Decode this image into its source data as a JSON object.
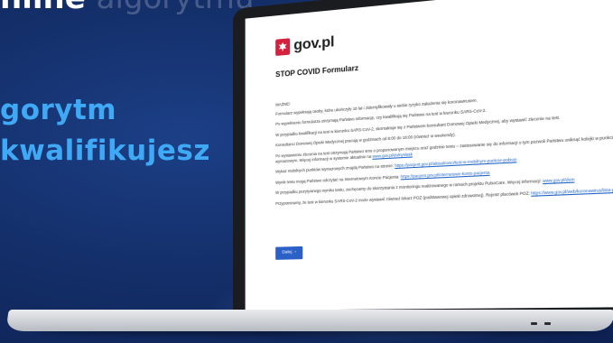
{
  "background": {
    "top_text": "nline",
    "top_text_faded": "algorytmu",
    "headline_lines": [
      "gorytm",
      "kwalifikujesz"
    ]
  },
  "screen": {
    "logo_text": "gov.pl",
    "form_title": "STOP COVID Formularz",
    "important_label": "WAŻNE!",
    "paragraphs": [
      "Formularz wypełniają osoby, które ukończyły 18 lat i zidentyfikowały u siebie ryzyko zakażenia się koronawirusem.",
      "Po wypełnieniu formularza otrzymają Państwo informację, czy kwalifikują się Państwo na test w kierunku SARS-CoV-2.",
      "W przypadku kwalifikacji na test w kierunku SARS-CoV-2, skontaktuje się z Państwem konsultant Domowej Opieki Medycznej, aby wystawić zlecenie na test.",
      "Konsultanci Domowej Opieki Medycznej pracują w godzinach od 8:00 do 18:00 (również w weekendy).",
      "Po wystawieniu zlecenia na test otrzymają Państwo sms o proponowanym miejscu oraz godzinie testu – zastosowanie się do informacji o tym pozwoli Państwu uniknąć kolejki w punkcie wymazowym. Więcej informacji w systemie aktualnie na",
      "Wykaz mobilnych punktów wymazowych znajdą Państwo na stronie:",
      "Wynik testu mogą Państwo odczytać na Internetowym Koncie Pacjenta:",
      "W przypadku pozytywnego wyniku testu, zachęcamy do skorzystania z monitoringu realizowanego w ramach projektu PulsoCare. Więcej informacji:",
      "Przypominamy, że test w kierunku SARS-CoV-2 może wystawić również lekarz POZ (podstawowej opieki zdrowotnej). Rejestr placówek POZ:"
    ],
    "links": {
      "p4": "www.gov.pl/dolnyslask",
      "p5": "https://pacjent.gov.pl/aktualnosci/test-w-mobilnym-punkcie-pobran",
      "p6": "https://pacjent.gov.pl/internetowe-konto-pacjenta",
      "p7": "www.gov.pl/dom",
      "p8": "https://www.gov.pl/web/koronawirus/lista-poz"
    },
    "next_button": "Dalej",
    "next_arrow": "›"
  },
  "colors": {
    "background": "#142f6a",
    "headline": "#3fa9f5",
    "button": "#2b60c7",
    "logo_red": "#d4213d"
  }
}
